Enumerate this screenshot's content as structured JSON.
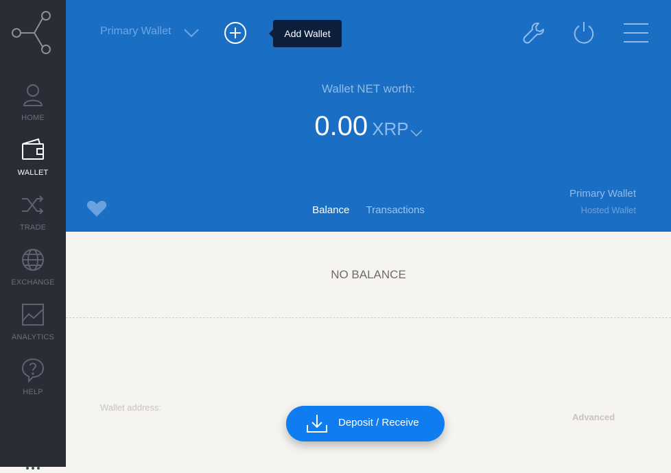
{
  "sidebar": {
    "items": [
      {
        "label": "HOME",
        "icon": "user-icon",
        "active": false
      },
      {
        "label": "WALLET",
        "icon": "wallet-icon",
        "active": true
      },
      {
        "label": "TRADE",
        "icon": "shuffle-icon",
        "active": false
      },
      {
        "label": "EXCHANGE",
        "icon": "globe-icon",
        "active": false
      },
      {
        "label": "ANALYTICS",
        "icon": "chart-icon",
        "active": false
      },
      {
        "label": "HELP",
        "icon": "help-icon",
        "active": false
      }
    ]
  },
  "header": {
    "wallet_selector": "Primary Wallet",
    "add_wallet_tooltip": "Add Wallet",
    "networth_label": "Wallet NET worth:",
    "networth_amount": "0.00",
    "networth_currency": "XRP",
    "tabs": [
      {
        "label": "Balance",
        "active": true
      },
      {
        "label": "Transactions",
        "active": false
      }
    ],
    "wallet_name": "Primary Wallet",
    "wallet_type": "Hosted Wallet"
  },
  "content": {
    "no_balance": "NO BALANCE",
    "wallet_address_label": "Wallet address:",
    "advanced_label": "Advanced",
    "deposit_button": "Deposit / Receive"
  },
  "colors": {
    "sidebar_bg": "#2a2d36",
    "header_bg": "#1a6fc4",
    "accent_button": "#0f7cf0",
    "content_bg": "#f5f4f1"
  }
}
